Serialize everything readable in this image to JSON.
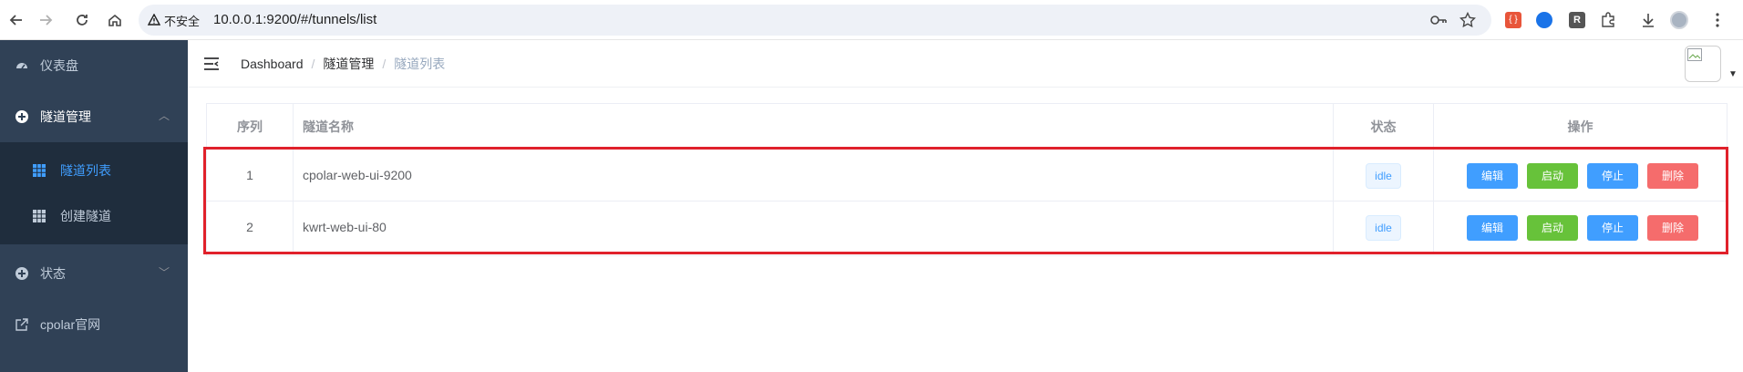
{
  "browser": {
    "insecure_label": "不安全",
    "url": "10.0.0.1:9200/#/tunnels/list",
    "ext_r_label": "R"
  },
  "sidebar": {
    "items": [
      {
        "label": "仪表盘",
        "icon": "dashboard-icon"
      },
      {
        "label": "隧道管理",
        "icon": "plus-circle-icon",
        "arrow": "︿"
      },
      {
        "label": "状态",
        "icon": "plus-circle-icon",
        "arrow": "﹀"
      },
      {
        "label": "cpolar官网",
        "icon": "external-link-icon"
      }
    ],
    "submenu": [
      {
        "label": "隧道列表",
        "icon": "grid-icon",
        "active": true
      },
      {
        "label": "创建隧道",
        "icon": "grid-icon",
        "active": false
      }
    ]
  },
  "header": {
    "breadcrumb": [
      "Dashboard",
      "隧道管理",
      "隧道列表"
    ],
    "separator": "/"
  },
  "table": {
    "columns": [
      "序列",
      "隧道名称",
      "状态",
      "操作"
    ],
    "rows": [
      {
        "index": "1",
        "name": "cpolar-web-ui-9200",
        "status": "idle"
      },
      {
        "index": "2",
        "name": "kwrt-web-ui-80",
        "status": "idle"
      }
    ],
    "actions": {
      "edit": "编辑",
      "start": "启动",
      "stop": "停止",
      "delete": "删除"
    }
  },
  "colors": {
    "sidebar_bg": "#304156",
    "submenu_bg": "#1f2d3d",
    "accent": "#409eff",
    "success": "#67c23a",
    "danger": "#f56c6c",
    "highlight": "#e0212b"
  }
}
